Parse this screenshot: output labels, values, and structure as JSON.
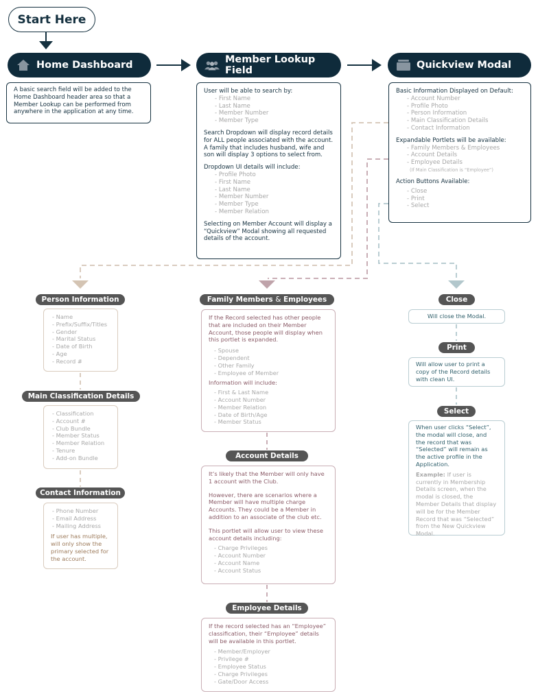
{
  "start": {
    "label": "Start Here"
  },
  "colors": {
    "header_bg": "#0f2b3b",
    "label_bg": "#555555",
    "tan": "#d9cbbd",
    "mauve": "#c9aeb5",
    "teal": "#b9cdd2"
  },
  "columns": [
    {
      "header": {
        "label": "Home Dashboard",
        "icon": "home-icon"
      },
      "description": "A basic search field will be added to the Home Dashboard header area so that a Member Lookup can be performed from anywhere in the application at any time."
    },
    {
      "header": {
        "label": "Member Lookup Field",
        "icon": "users-icon"
      },
      "sections": [
        {
          "title": "User will be able to search by:",
          "items": [
            "- First Name",
            "- Last Name",
            "- Member Number",
            "- Member Type"
          ]
        },
        {
          "title": "Search Dropdown will display record details for ALL people associated with the account. A family that includes husband, wife and son will display 3 options to select from.",
          "items": []
        },
        {
          "title": "Dropdown UI details will include:",
          "items": [
            "- Profile Photo",
            "- First Name",
            "- Last Name",
            "- Member Number",
            "- Member Type",
            "- Member Relation"
          ]
        },
        {
          "title": "Selecting on Member Account will display a “Quickview” Modal showing all requested details of the account.",
          "items": []
        }
      ]
    },
    {
      "header": {
        "label": "Quickview Modal",
        "icon": "modal-stack-icon"
      },
      "sections": [
        {
          "title": "Basic Information Displayed on Default:",
          "items": [
            "- Account Number",
            "- Profile Photo",
            "- Person Information",
            "- Main Classification Details",
            "- Contact Information"
          ]
        },
        {
          "title": "Expandable Portlets will be available:",
          "items": [
            "- Family Members & Employees",
            "- Account Details",
            "- Employee Details"
          ],
          "note": "(If Main Classification is “Employee”)"
        },
        {
          "title": "Action Buttons Available:",
          "items": [
            "- Close",
            "- Print",
            "- Select"
          ]
        }
      ]
    }
  ],
  "left_branch": [
    {
      "label": "Person Information",
      "items": [
        "- Name",
        "- Prefix/Suffix/Titles",
        "- Gender",
        "- Marital Status",
        "- Date of Birth",
        "- Age",
        "- Record #"
      ]
    },
    {
      "label": "Main Classification Details",
      "items": [
        "- Classification",
        "- Account #",
        "- Club Bundle",
        "- Member Status",
        "- Member Relation",
        "- Tenure",
        "- Add-on Bundle"
      ]
    },
    {
      "label": "Contact Information",
      "items": [
        "- Phone Number",
        "- Email Address",
        "- Mailing Address"
      ],
      "note": "If user has multiple, will only show the primary selected for the account."
    }
  ],
  "middle_branch": [
    {
      "label_a": "Family Members",
      "label_amp": "&",
      "label_b": "Employees",
      "intro": "If the Record selected has other people that are included on their Member Account, those people will display when this portlet is expanded.",
      "items": [
        "- Spouse",
        "- Dependent",
        "- Other Family",
        "- Employee of Member"
      ],
      "subtitle": "Information will include:",
      "items2": [
        "- First & Last Name",
        "- Account Number",
        "- Member Relation",
        "- Date of Birth/Age",
        "- Member Status"
      ]
    },
    {
      "label": "Account Details",
      "p1": "It’s likely that the Member will only have 1 account with the Club.",
      "p2": "However, there are scenarios where a Member will have multiple charge Accounts. They could be a Member in addition to an associate of the club etc.",
      "p3": "This portlet will allow user to view these account details including:",
      "items": [
        "- Charge Privileges",
        "- Account Number",
        "- Account Name",
        "- Account Status"
      ]
    },
    {
      "label": "Employee Details",
      "intro": "If the record selected has an “Employee” classification, their “Employee” details will be available in this portlet.",
      "items": [
        "- Member/Employer",
        "- Privilege #",
        "- Employee Status",
        "- Charge Privileges",
        "- Gate/Door Access"
      ]
    }
  ],
  "right_branch": [
    {
      "label": "Close",
      "text": "Will close the Modal."
    },
    {
      "label": "Print",
      "text": "Will allow user to print a copy of the Record details with clean UI."
    },
    {
      "label": "Select",
      "text": "When user clicks “Select”, the modal will close, and the record that was “Selected” will remain as the active profile in the Application.",
      "example_label": "Example:",
      "example_text": " If user is currently in Membership Details screen, when the modal is closed, the Member Details that display will be for the Member Record that was “Selected” from the New Quickview Modal."
    }
  ]
}
